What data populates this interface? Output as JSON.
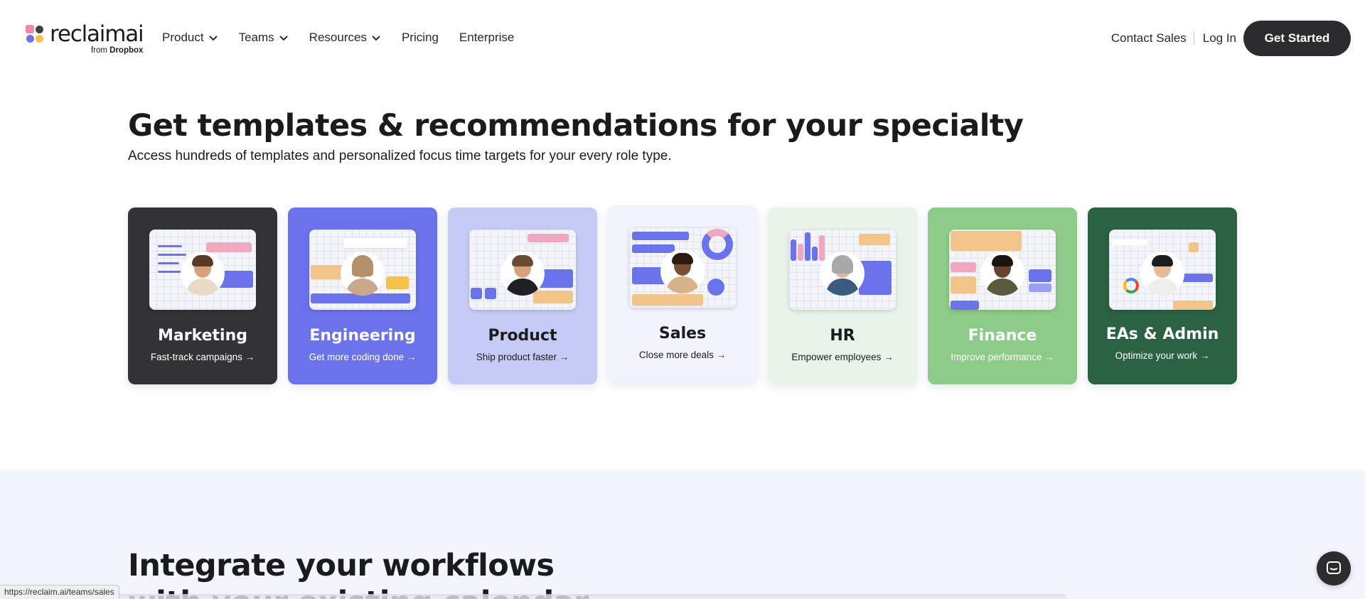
{
  "header": {
    "logo_word": "reclaimai",
    "logo_sub_prefix": "from",
    "logo_sub_brand": "Dropbox",
    "nav": [
      {
        "label": "Product",
        "has_menu": true
      },
      {
        "label": "Teams",
        "has_menu": true
      },
      {
        "label": "Resources",
        "has_menu": true
      },
      {
        "label": "Pricing",
        "has_menu": false
      },
      {
        "label": "Enterprise",
        "has_menu": false
      }
    ],
    "contact_sales": "Contact Sales",
    "log_in": "Log In",
    "get_started": "Get Started"
  },
  "specialty": {
    "title": "Get templates & recommendations for your specialty",
    "subtitle": "Access hundreds of templates and personalized focus time targets for your every role type.",
    "cards": [
      {
        "title": "Marketing",
        "subtitle": "Fast-track campaigns →",
        "bg": "#333335",
        "fg": "#ffffff"
      },
      {
        "title": "Engineering",
        "subtitle": "Get more coding done →",
        "bg": "#6b73eb",
        "fg": "#ffffff"
      },
      {
        "title": "Product",
        "subtitle": "Ship product faster →",
        "bg": "#c6cbf6",
        "fg": "#1b1b1f"
      },
      {
        "title": "Sales",
        "subtitle": "Close more deals →",
        "bg": "#f1f3fd",
        "fg": "#1b1b1f"
      },
      {
        "title": "HR",
        "subtitle": "Empower employees →",
        "bg": "#e8f4ea",
        "fg": "#1b1b1f"
      },
      {
        "title": "Finance",
        "subtitle": "Improve performance →",
        "bg": "#8ccb88",
        "fg": "#ffffff"
      },
      {
        "title": "EAs & Admin",
        "subtitle": "Optimize your work →",
        "bg": "#2a6243",
        "fg": "#ffffff"
      }
    ]
  },
  "integrate": {
    "title": "Integrate your workflows with your existing calendar"
  },
  "status_bar": {
    "url": "https://reclaim.ai/teams/sales"
  },
  "colors": {
    "accent_periwinkle": "#6b73eb",
    "peach": "#f2c48a",
    "pink": "#f0a8be",
    "dark": "#2c2c2e"
  }
}
